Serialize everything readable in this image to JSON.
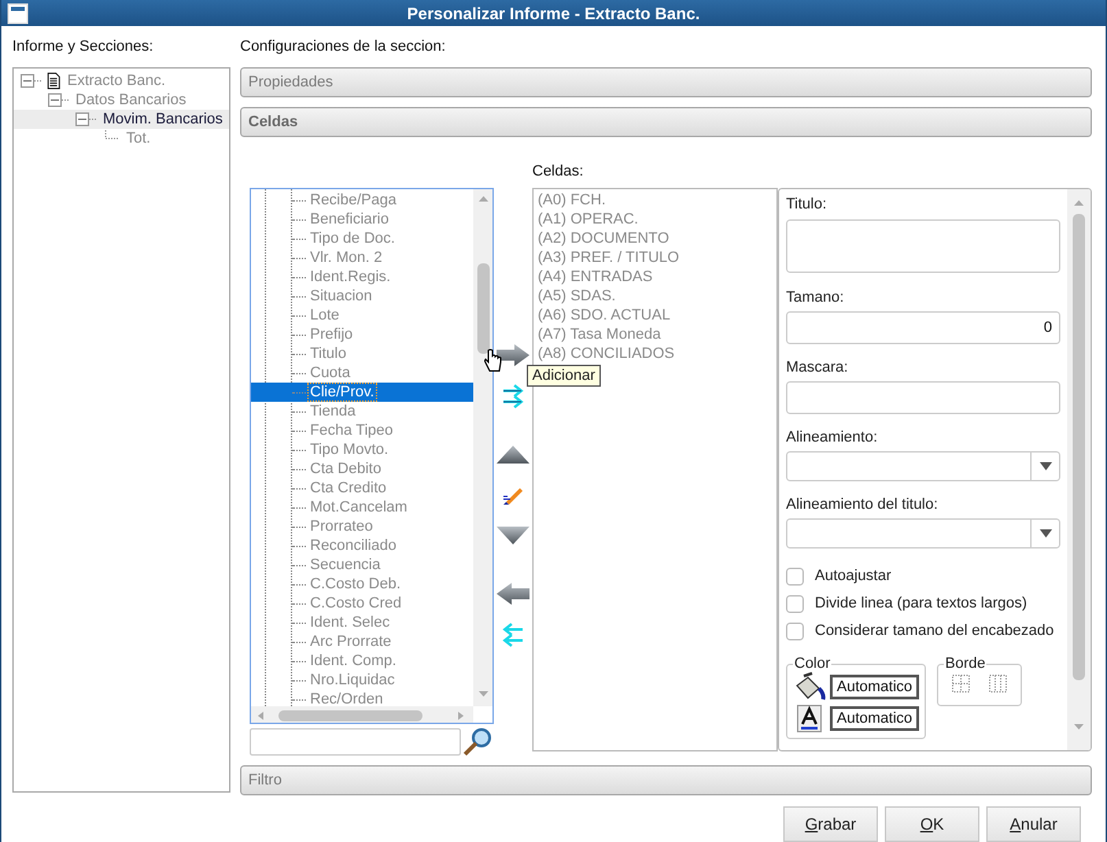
{
  "window": {
    "title": "Personalizar Informe - Extracto Banc."
  },
  "sections_panel": {
    "label": "Informe y Secciones:",
    "tree": [
      {
        "label": "Extracto Banc.",
        "expanded": true,
        "selected": false,
        "children": [
          {
            "label": "Datos Bancarios",
            "expanded": true,
            "selected": false,
            "children": [
              {
                "label": "Movim. Bancarios",
                "expanded": true,
                "selected": true,
                "children": [
                  {
                    "label": "Tot.",
                    "selected": false
                  }
                ]
              }
            ]
          }
        ]
      }
    ]
  },
  "config": {
    "label": "Configuraciones de la seccion:",
    "sections": [
      {
        "label": "Propiedades",
        "expanded": false
      },
      {
        "label": "Celdas",
        "expanded": true
      },
      {
        "label": "Filtro",
        "expanded": false
      }
    ]
  },
  "fields": [
    {
      "label": "Recibe/Paga",
      "selected": false
    },
    {
      "label": "Beneficiario",
      "selected": false
    },
    {
      "label": "Tipo de Doc.",
      "selected": false
    },
    {
      "label": "Vlr. Mon. 2",
      "selected": false
    },
    {
      "label": "Ident.Regis.",
      "selected": false
    },
    {
      "label": "Situacion",
      "selected": false
    },
    {
      "label": "Lote",
      "selected": false
    },
    {
      "label": "Prefijo",
      "selected": false
    },
    {
      "label": "Titulo",
      "selected": false
    },
    {
      "label": "Cuota",
      "selected": false
    },
    {
      "label": "Clie/Prov.",
      "selected": true
    },
    {
      "label": "Tienda",
      "selected": false
    },
    {
      "label": "Fecha Tipeo",
      "selected": false
    },
    {
      "label": "Tipo Movto.",
      "selected": false
    },
    {
      "label": "Cta Debito",
      "selected": false
    },
    {
      "label": "Cta Credito",
      "selected": false
    },
    {
      "label": "Mot.Cancelam",
      "selected": false
    },
    {
      "label": "Prorrateo",
      "selected": false
    },
    {
      "label": "Reconciliado",
      "selected": false
    },
    {
      "label": "Secuencia",
      "selected": false
    },
    {
      "label": "C.Costo Deb.",
      "selected": false
    },
    {
      "label": "C.Costo Cred",
      "selected": false
    },
    {
      "label": "Ident. Selec",
      "selected": false
    },
    {
      "label": "Arc Prorrate",
      "selected": false
    },
    {
      "label": "Ident. Comp.",
      "selected": false
    },
    {
      "label": "Nro.Liquidac",
      "selected": false
    },
    {
      "label": "Rec/Orden",
      "selected": false
    }
  ],
  "tooltip": "Adicionar",
  "cells": {
    "label": "Celdas:",
    "items": [
      "(A0) FCH.",
      "(A1) OPERAC.",
      "(A2) DOCUMENTO",
      "(A3) PREF. / TITULO",
      "(A4) ENTRADAS",
      "(A5) SDAS.",
      "(A6) SDO. ACTUAL",
      "(A7) Tasa Moneda",
      "(A8) CONCILIADOS"
    ]
  },
  "properties": {
    "titulo": {
      "label": "Titulo:"
    },
    "tamano": {
      "label": "Tamano:",
      "value": "0"
    },
    "mascara": {
      "label": "Mascara:"
    },
    "alineamiento": {
      "label": "Alineamiento:"
    },
    "alineamiento_titulo": {
      "label": "Alineamiento del titulo:"
    },
    "checkboxes": [
      {
        "label": "Autoajustar",
        "checked": false
      },
      {
        "label": "Divide linea (para textos largos)",
        "checked": false
      },
      {
        "label": "Considerar tamano del encabezado",
        "checked": false
      }
    ],
    "color": {
      "label": "Color",
      "background": "Automatico",
      "font": "Automatico"
    },
    "borde": {
      "label": "Borde"
    }
  },
  "buttons": [
    "Grabar",
    "OK",
    "Anular"
  ]
}
